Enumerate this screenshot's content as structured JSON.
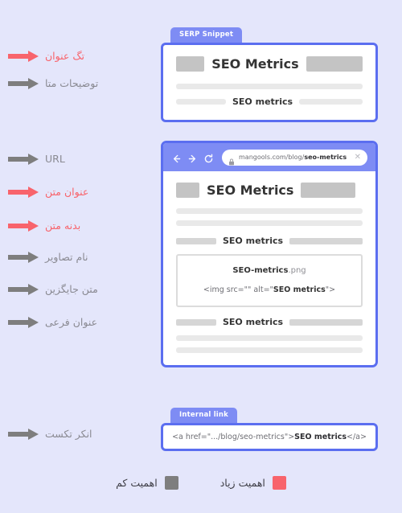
{
  "page": {
    "background_color": "#e4e6fb",
    "accent_blue": "#5b6ef0",
    "tab_blue": "#7e8cf4",
    "high_importance_color": "#f8646c",
    "low_importance_color": "#7e7e7e"
  },
  "annotations": [
    {
      "label": "تگ عنوان",
      "importance": "high",
      "target": "serp-title"
    },
    {
      "label": "توضیحات متا",
      "importance": "low",
      "target": "serp-description"
    },
    {
      "label": "URL",
      "importance": "low",
      "target": "browser-url"
    },
    {
      "label": "عنوان متن",
      "importance": "high",
      "target": "page-heading"
    },
    {
      "label": "بدنه متن",
      "importance": "high",
      "target": "page-body"
    },
    {
      "label": "نام تصاویر",
      "importance": "low",
      "target": "image-filename"
    },
    {
      "label": "متن جایگزین",
      "importance": "low",
      "target": "image-alt"
    },
    {
      "label": "عنوان فرعی",
      "importance": "low",
      "target": "page-subheading"
    },
    {
      "label": "انکر تکست",
      "importance": "low",
      "target": "internal-link"
    }
  ],
  "serp_snippet": {
    "tab_label": "SERP Snippet",
    "title": "SEO Metrics",
    "keyword": "SEO metrics"
  },
  "browser": {
    "back_icon": "arrow-left-icon",
    "forward_icon": "arrow-right-icon",
    "reload_icon": "reload-icon",
    "lock_icon": "lock-icon",
    "close_icon": "close-icon",
    "url_prefix": "mangools.com/blog/",
    "url_slug": "seo-metrics",
    "url_close_glyph": "✕",
    "page": {
      "heading": "SEO Metrics",
      "subheading": "SEO metrics",
      "image_name_bold": "SEO-metrics",
      "image_name_ext": ".png",
      "img_tag_prefix": "<img src=\"\" alt=\"",
      "img_tag_alt": "SEO metrics",
      "img_tag_suffix": "\">"
    }
  },
  "internal_link": {
    "tab_label": "Internal link",
    "code_prefix": "<a href=\".../blog/seo-metrics\">",
    "code_anchor": "SEO metrics",
    "code_suffix": "</a>"
  },
  "legend": {
    "high": {
      "label": "اهمیت زیاد",
      "color": "#f8646c"
    },
    "low": {
      "label": "اهمیت کم",
      "color": "#7e7e7e"
    }
  }
}
